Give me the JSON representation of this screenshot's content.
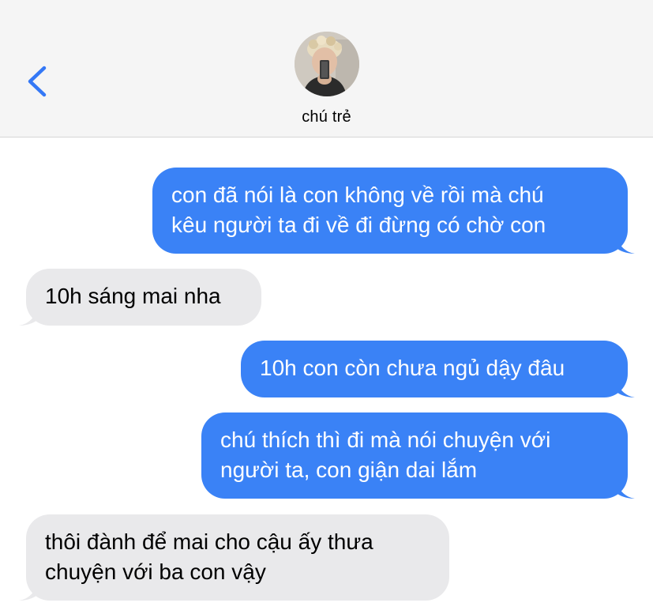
{
  "header": {
    "contact_name": "chú trẻ",
    "back_icon": "chevron-left-icon",
    "avatar_icon": "avatar-photo"
  },
  "colors": {
    "sent_bubble": "#3a82f6",
    "received_bubble": "#e9e9eb",
    "accent": "#3478f6",
    "header_bg": "#f5f5f5"
  },
  "messages": [
    {
      "direction": "sent",
      "lines": [
        "con đã nói là con không về rồi mà chú",
        "kêu người ta đi về đi đừng có chờ con"
      ]
    },
    {
      "direction": "received",
      "lines": [
        "10h sáng mai nha"
      ]
    },
    {
      "direction": "sent",
      "lines": [
        "10h con còn chưa ngủ dậy đâu"
      ]
    },
    {
      "direction": "sent",
      "lines": [
        "chú thích thì đi mà nói chuyện với",
        "người ta, con giận dai lắm"
      ]
    },
    {
      "direction": "received",
      "lines": [
        "thôi đành để mai cho cậu ấy thưa",
        "chuyện với ba con vậy"
      ]
    }
  ]
}
